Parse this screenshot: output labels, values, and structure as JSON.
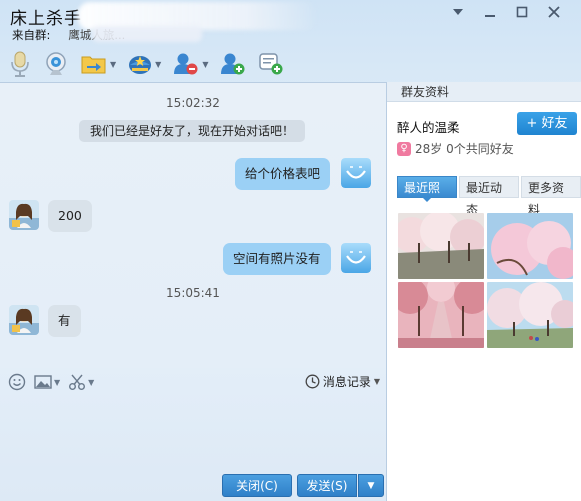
{
  "window": {
    "title": "床上杀手",
    "from_label": "来自群:",
    "from_value": "鹰城人旅..."
  },
  "toolbar": {
    "icons": [
      "microphone-icon",
      "video-icon",
      "file-transfer-icon",
      "app-icon",
      "block-user-icon",
      "add-user-icon",
      "new-message-icon"
    ]
  },
  "chat": {
    "messages": [
      {
        "kind": "time",
        "text": "15:02:32"
      },
      {
        "kind": "system",
        "text": "我们已经是好友了，现在开始对话吧！"
      },
      {
        "kind": "me",
        "text": "给个价格表吧"
      },
      {
        "kind": "them",
        "text": "200"
      },
      {
        "kind": "me",
        "text": "空间有照片没有"
      },
      {
        "kind": "time",
        "text": "15:05:41"
      },
      {
        "kind": "them",
        "text": "有"
      }
    ]
  },
  "input_toolbar": {
    "history_label": "消息记录"
  },
  "buttons": {
    "close_label": "关闭(C)",
    "send_label": "发送(S)"
  },
  "profile": {
    "header": "群友资料",
    "name": "醉人的温柔",
    "add_friend_label": "+ 好友",
    "info": "28岁  0个共同好友",
    "tabs": [
      "最近照片",
      "最近动态",
      "更多资料"
    ],
    "active_tab": "最近照片"
  },
  "colors": {
    "my_bubble": "#9bd0f5",
    "their_bubble": "#d9e2ea",
    "primary_button": "#2f80c8"
  }
}
